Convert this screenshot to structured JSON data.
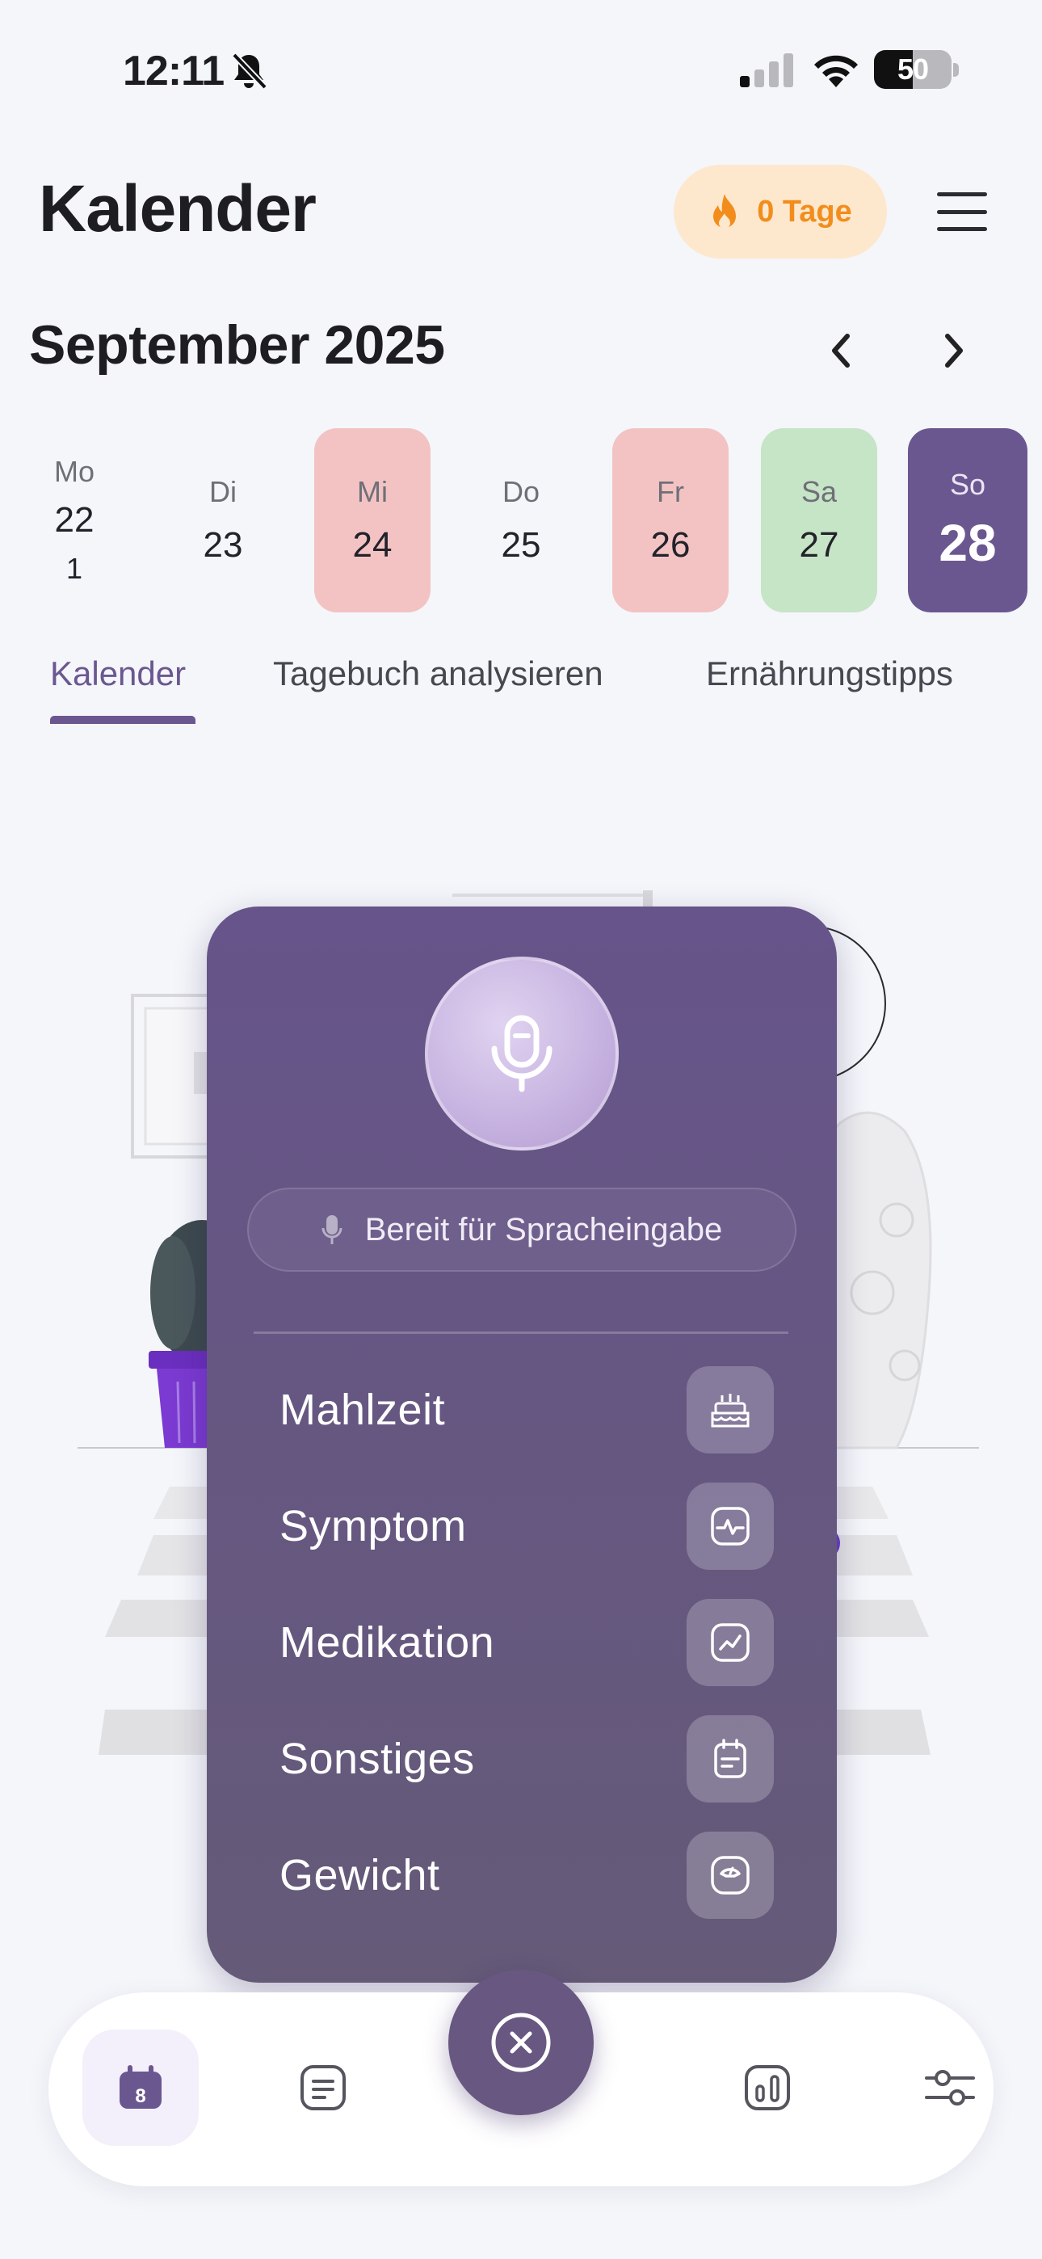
{
  "status_bar": {
    "time": "12:11",
    "battery": "50",
    "icons": [
      "bell-slash-icon",
      "cellular-signal-icon",
      "wifi-icon",
      "battery-icon"
    ]
  },
  "header": {
    "title": "Kalender",
    "streak_label": "0 Tage",
    "streak_icon": "flame-icon",
    "menu_icon": "hamburger-menu-icon"
  },
  "calendar": {
    "month_label": "September 2025",
    "prev_icon": "chevron-left-icon",
    "next_icon": "chevron-right-icon",
    "days": [
      {
        "name": "Mo",
        "num": "22",
        "badge": "1",
        "status": "none"
      },
      {
        "name": "Di",
        "num": "23",
        "status": "none"
      },
      {
        "name": "Mi",
        "num": "24",
        "status": "red"
      },
      {
        "name": "Do",
        "num": "25",
        "status": "none"
      },
      {
        "name": "Fr",
        "num": "26",
        "status": "red"
      },
      {
        "name": "Sa",
        "num": "27",
        "status": "green"
      },
      {
        "name": "So",
        "num": "28",
        "status": "selected"
      }
    ]
  },
  "tabs": [
    {
      "label": "Kalender",
      "active": true
    },
    {
      "label": "Tagebuch analysieren",
      "active": false
    },
    {
      "label": "Ernährungstipps",
      "active": false
    }
  ],
  "popup": {
    "mic_icon": "microphone-icon",
    "voice_status": "Bereit für Spracheingabe",
    "entries": [
      {
        "label": "Mahlzeit",
        "icon": "cake-icon"
      },
      {
        "label": "Symptom",
        "icon": "pulse-monitor-icon"
      },
      {
        "label": "Medikation",
        "icon": "trend-chart-icon"
      },
      {
        "label": "Sonstiges",
        "icon": "notes-icon"
      },
      {
        "label": "Gewicht",
        "icon": "scale-icon"
      }
    ]
  },
  "bottom_nav": {
    "calendar_badge": "8",
    "items": [
      "calendar-icon",
      "list-icon",
      "close-icon",
      "bar-chart-icon",
      "sliders-icon"
    ],
    "active_index": 0
  },
  "colors": {
    "accent": "#6b5790",
    "streak_bg": "#fde8cd",
    "streak_text": "#f28d1c",
    "day_red": "#f3c3c3",
    "day_green": "#c6e4c6",
    "popup_bg": "#66548a"
  }
}
